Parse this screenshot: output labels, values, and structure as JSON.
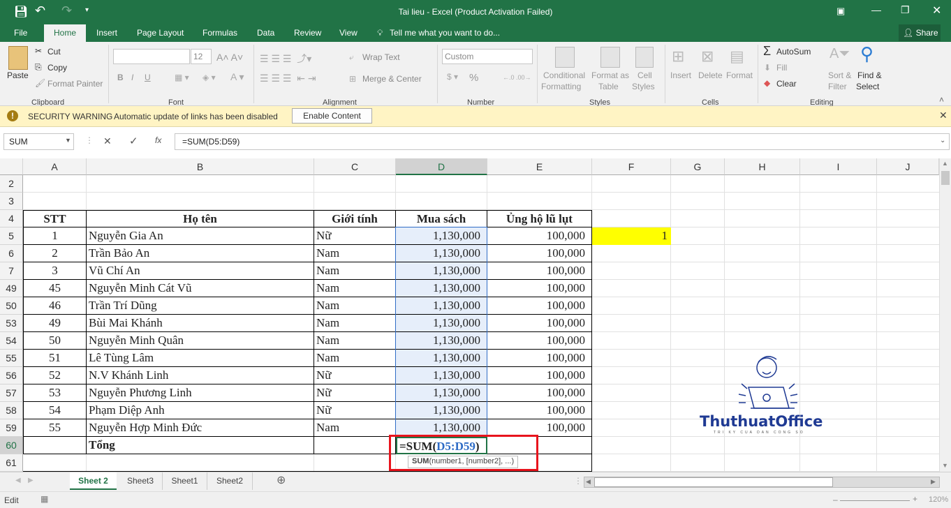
{
  "window": {
    "title": "Tai lieu - Excel (Product Activation Failed)"
  },
  "tabs": [
    "File",
    "Home",
    "Insert",
    "Page Layout",
    "Formulas",
    "Data",
    "Review",
    "View"
  ],
  "tell_me": "Tell me what you want to do...",
  "share": "Share",
  "ribbon": {
    "clipboard": {
      "paste": "Paste",
      "cut": "Cut",
      "copy": "Copy",
      "format_painter": "Format Painter",
      "label": "Clipboard"
    },
    "font": {
      "size": "12",
      "label": "Font",
      "bold": "B",
      "italic": "I",
      "underline": "U"
    },
    "alignment": {
      "wrap": "Wrap Text",
      "merge": "Merge & Center",
      "label": "Alignment"
    },
    "number": {
      "format": "Custom",
      "percent": "%",
      "label": "Number"
    },
    "styles": {
      "conditional": "Conditional",
      "formatting": "Formatting",
      "format_as": "Format as",
      "table": "Table",
      "cell": "Cell",
      "cell_styles": "Styles",
      "label": "Styles"
    },
    "cells": {
      "insert": "Insert",
      "delete": "Delete",
      "format": "Format",
      "label": "Cells"
    },
    "editing": {
      "autosum": "AutoSum",
      "fill": "Fill",
      "clear": "Clear",
      "sort": "Sort &",
      "filter": "Filter",
      "find": "Find &",
      "select": "Select",
      "label": "Editing"
    }
  },
  "security": {
    "title": "SECURITY WARNING",
    "message": "Automatic update of links has been disabled",
    "button": "Enable Content"
  },
  "formula_bar": {
    "name_box": "SUM",
    "formula": "=SUM(D5:D59)",
    "fx": "fx"
  },
  "columns": [
    "A",
    "B",
    "C",
    "D",
    "E",
    "F",
    "G",
    "H",
    "I",
    "J"
  ],
  "header_row": {
    "row": "4",
    "stt": "STT",
    "name": "Họ tên",
    "gender": "Giới tính",
    "books": "Mua sách",
    "flood": "Ủng hộ lũ lụt"
  },
  "empty_rows": [
    "2",
    "3"
  ],
  "rows": [
    {
      "row": "5",
      "stt": "1",
      "name": "Nguyễn Gia An",
      "gender": "Nữ",
      "books": "1,130,000",
      "flood": "100,000"
    },
    {
      "row": "6",
      "stt": "2",
      "name": "Trần Bảo An",
      "gender": "Nam",
      "books": "1,130,000",
      "flood": "100,000"
    },
    {
      "row": "7",
      "stt": "3",
      "name": "Vũ Chí An",
      "gender": "Nam",
      "books": "1,130,000",
      "flood": "100,000"
    },
    {
      "row": "49",
      "stt": "45",
      "name": "Nguyễn Minh Cát Vũ",
      "gender": "Nam",
      "books": "1,130,000",
      "flood": "100,000"
    },
    {
      "row": "50",
      "stt": "46",
      "name": "Trần Trí Dũng",
      "gender": "Nam",
      "books": "1,130,000",
      "flood": "100,000"
    },
    {
      "row": "53",
      "stt": "49",
      "name": "Bùi Mai Khánh",
      "gender": "Nam",
      "books": "1,130,000",
      "flood": "100,000"
    },
    {
      "row": "54",
      "stt": "50",
      "name": "Nguyễn Minh Quân",
      "gender": "Nam",
      "books": "1,130,000",
      "flood": "100,000"
    },
    {
      "row": "55",
      "stt": "51",
      "name": "Lê Tùng Lâm",
      "gender": "Nam",
      "books": "1,130,000",
      "flood": "100,000"
    },
    {
      "row": "56",
      "stt": "52",
      "name": "N.V Khánh Linh",
      "gender": "Nữ",
      "books": "1,130,000",
      "flood": "100,000"
    },
    {
      "row": "57",
      "stt": "53",
      "name": "Nguyễn Phương Linh",
      "gender": "Nữ",
      "books": "1,130,000",
      "flood": "100,000"
    },
    {
      "row": "58",
      "stt": "54",
      "name": "Phạm Diệp Anh",
      "gender": "Nữ",
      "books": "1,130,000",
      "flood": "100,000"
    },
    {
      "row": "59",
      "stt": "55",
      "name": "Nguyễn Hợp Minh Đức",
      "gender": "Nam",
      "books": "1,130,000",
      "flood": "100,000"
    }
  ],
  "f5_value": "1",
  "total_row": {
    "row": "60",
    "label": "Tổng",
    "formula_prefix": "=SUM(",
    "formula_range": "D5:D59",
    "formula_suffix": ")"
  },
  "tooltip": {
    "fn": "SUM",
    "args": "(number1, [number2], ...)"
  },
  "last_row": "61",
  "logo": {
    "text": "ThuthuatOffice",
    "tagline": "TRI KY CUA DAN CONG SO"
  },
  "sheets": [
    "Sheet 2",
    "Sheet3",
    "Sheet1",
    "Sheet2"
  ],
  "active_sheet": "Sheet 2",
  "status": {
    "mode": "Edit",
    "zoom": "120%"
  },
  "colors": {
    "excel_green": "#217346",
    "highlight": "#ffff00",
    "range_blue": "#2f6cc6",
    "callout_red": "#e8141d"
  }
}
